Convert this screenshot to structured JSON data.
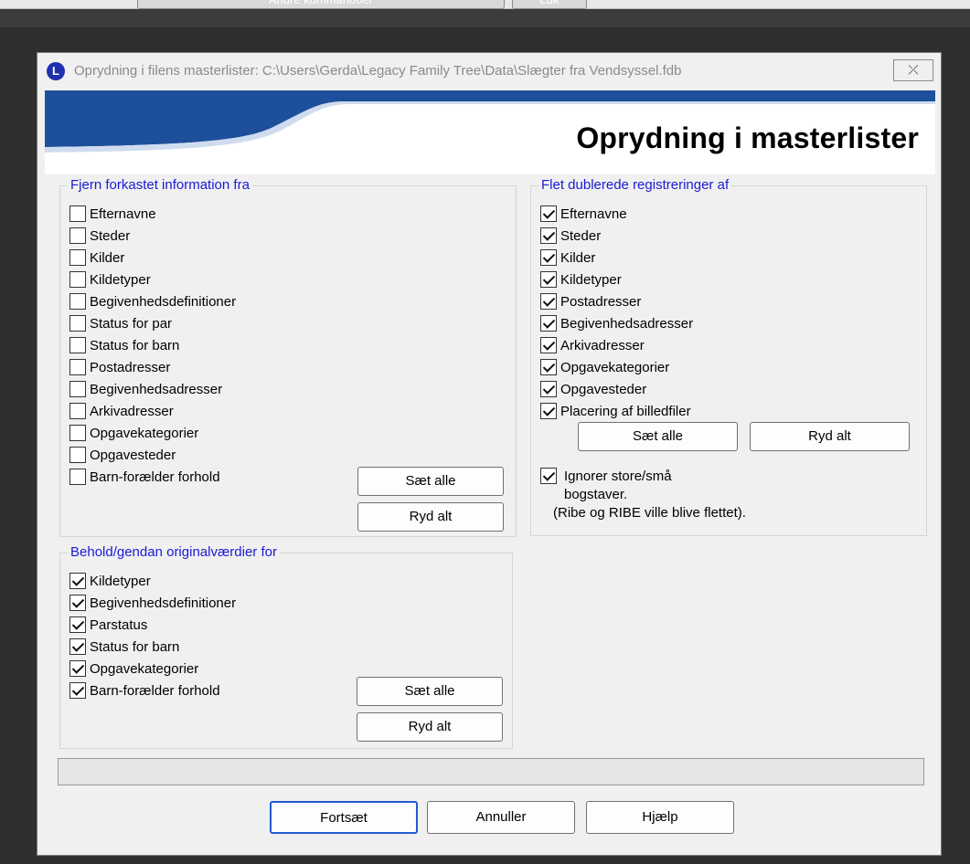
{
  "background_app": {
    "buttons": [
      "Andre kommandoer",
      "Luk"
    ]
  },
  "dialog": {
    "title": "Oprydning i filens masterlister: C:\\Users\\Gerda\\Legacy Family Tree\\Data\\Slægter fra Vendsyssel.fdb",
    "icon_letter": "L",
    "close_symbol": "⤫",
    "banner_title": "Oprydning i masterlister"
  },
  "remove_group": {
    "legend": "Fjern forkastet information fra",
    "items": [
      {
        "label": "Efternavne",
        "checked": false
      },
      {
        "label": "Steder",
        "checked": false
      },
      {
        "label": "Kilder",
        "checked": false
      },
      {
        "label": "Kildetyper",
        "checked": false
      },
      {
        "label": "Begivenhedsdefinitioner",
        "checked": false
      },
      {
        "label": "Status for par",
        "checked": false
      },
      {
        "label": "Status for barn",
        "checked": false
      },
      {
        "label": "Postadresser",
        "checked": false
      },
      {
        "label": "Begivenhedsadresser",
        "checked": false
      },
      {
        "label": "Arkivadresser",
        "checked": false
      },
      {
        "label": "Opgavekategorier",
        "checked": false
      },
      {
        "label": "Opgavesteder",
        "checked": false
      },
      {
        "label": "Barn-forælder forhold",
        "checked": false
      }
    ],
    "set_all": "Sæt alle",
    "clear_all": "Ryd alt"
  },
  "merge_group": {
    "legend": "Flet dublerede registreringer af",
    "items": [
      {
        "label": "Efternavne",
        "checked": true
      },
      {
        "label": "Steder",
        "checked": true
      },
      {
        "label": "Kilder",
        "checked": true
      },
      {
        "label": "Kildetyper",
        "checked": true
      },
      {
        "label": "Postadresser",
        "checked": true
      },
      {
        "label": "Begivenhedsadresser",
        "checked": true
      },
      {
        "label": "Arkivadresser",
        "checked": true
      },
      {
        "label": "Opgavekategorier",
        "checked": true
      },
      {
        "label": "Opgavesteder",
        "checked": true
      },
      {
        "label": "Placering af billedfiler",
        "checked": true
      }
    ],
    "set_all": "Sæt alle",
    "clear_all": "Ryd alt",
    "ignore_case": {
      "checked": true,
      "line1": "Ignorer store/små",
      "line2": "bogstaver.",
      "line3": "(Ribe og RIBE ville blive flettet)."
    }
  },
  "keep_group": {
    "legend": "Behold/gendan originalværdier for",
    "items": [
      {
        "label": "Kildetyper",
        "checked": true
      },
      {
        "label": "Begivenhedsdefinitioner",
        "checked": true
      },
      {
        "label": "Parstatus",
        "checked": true
      },
      {
        "label": "Status for barn",
        "checked": true
      },
      {
        "label": "Opgavekategorier",
        "checked": true
      },
      {
        "label": "Barn-forælder forhold",
        "checked": true
      }
    ],
    "set_all": "Sæt alle",
    "clear_all": "Ryd alt"
  },
  "footer": {
    "continue": "Fortsæt",
    "cancel": "Annuller",
    "help": "Hjælp"
  },
  "colors": {
    "legend": "#1a1ad8",
    "banner_blue": "#1d4f9a",
    "default_button_border": "#1e5bd6"
  }
}
